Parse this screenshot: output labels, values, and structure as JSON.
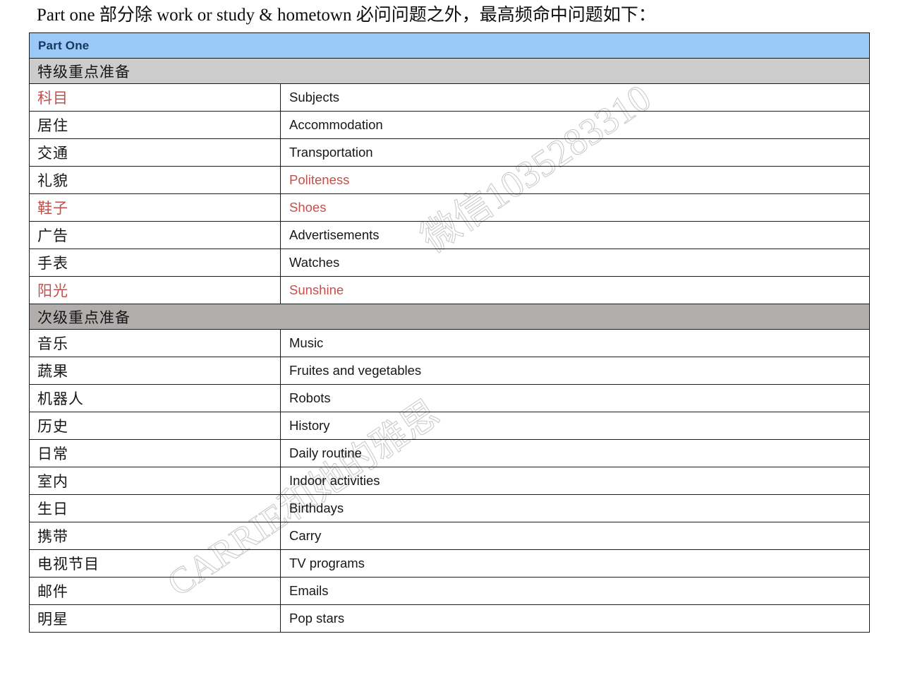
{
  "document": {
    "title_line": "Part one 部分除 work or study & hometown 必问问题之外，最高频命中问题如下：",
    "watermark_top": "微信1035283310",
    "watermark_bottom": "CARRIE和她的雅思"
  },
  "colors": {
    "header_bg": "#9bc9f7",
    "header_text": "#17365d",
    "section_a_bg": "#cccccc",
    "section_b_bg": "#b2adad",
    "highlight_red": "#c0504d",
    "border": "#1a1a1a"
  },
  "table": {
    "header": "Part One",
    "sections": [
      {
        "label": "特级重点准备",
        "style": "primary",
        "rows": [
          {
            "zh": "科目",
            "en": "Subjects",
            "zh_red": true,
            "en_red": false
          },
          {
            "zh": "居住",
            "en": "Accommodation",
            "zh_red": false,
            "en_red": false
          },
          {
            "zh": "交通",
            "en": "Transportation",
            "zh_red": false,
            "en_red": false
          },
          {
            "zh": "礼貌",
            "en": "Politeness",
            "zh_red": false,
            "en_red": true
          },
          {
            "zh": "鞋子",
            "en": "Shoes",
            "zh_red": true,
            "en_red": true
          },
          {
            "zh": "广告",
            "en": "Advertisements",
            "zh_red": false,
            "en_red": false
          },
          {
            "zh": "手表",
            "en": "Watches",
            "zh_red": false,
            "en_red": false
          },
          {
            "zh": "阳光",
            "en": "Sunshine",
            "zh_red": true,
            "en_red": true
          }
        ]
      },
      {
        "label": "次级重点准备",
        "style": "secondary",
        "rows": [
          {
            "zh": "音乐",
            "en": "Music",
            "zh_red": false,
            "en_red": false
          },
          {
            "zh": "蔬果",
            "en": "Fruites and vegetables",
            "zh_red": false,
            "en_red": false
          },
          {
            "zh": "机器人",
            "en": "Robots",
            "zh_red": false,
            "en_red": false
          },
          {
            "zh": "历史",
            "en": "History",
            "zh_red": false,
            "en_red": false
          },
          {
            "zh": "日常",
            "en": "Daily routine",
            "zh_red": false,
            "en_red": false
          },
          {
            "zh": "室内",
            "en": "Indoor activities",
            "zh_red": false,
            "en_red": false
          },
          {
            "zh": "生日",
            "en": "Birthdays",
            "zh_red": false,
            "en_red": false
          },
          {
            "zh": "携带",
            "en": "Carry",
            "zh_red": false,
            "en_red": false
          },
          {
            "zh": "电视节目",
            "en": "TV programs",
            "zh_red": false,
            "en_red": false
          },
          {
            "zh": "邮件",
            "en": "Emails",
            "zh_red": false,
            "en_red": false
          },
          {
            "zh": "明星",
            "en": "Pop stars",
            "zh_red": false,
            "en_red": false
          }
        ]
      }
    ]
  }
}
